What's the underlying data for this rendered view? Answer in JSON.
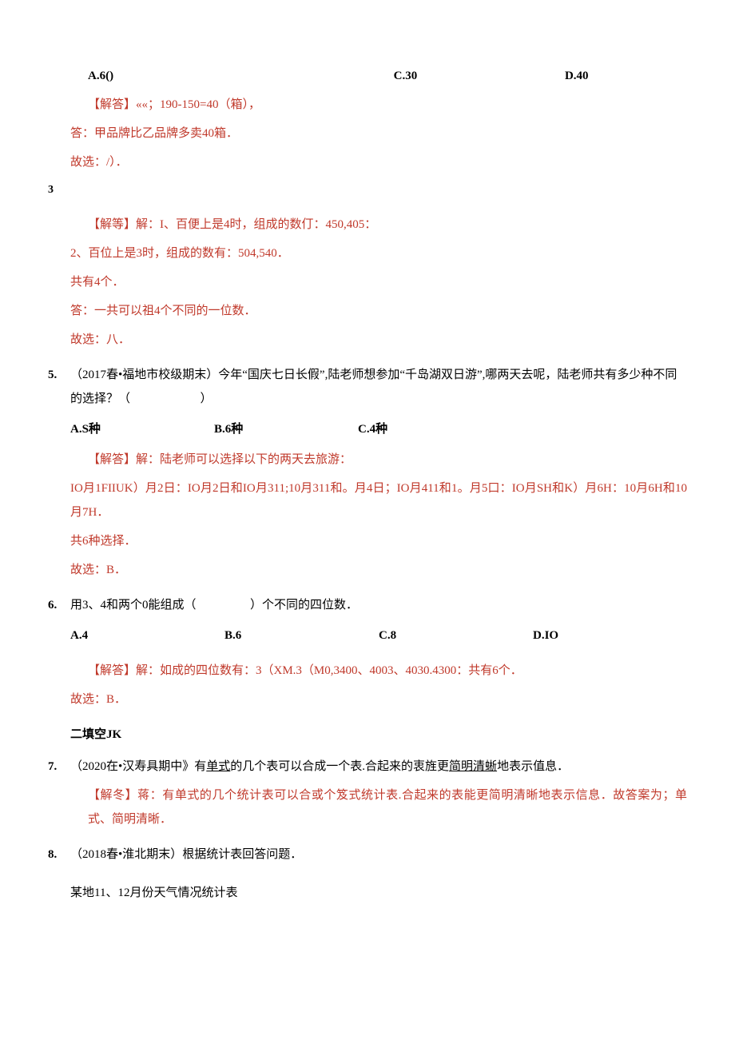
{
  "q_top_opts": {
    "a": "A.6()",
    "c": "C.30",
    "d": "D.40"
  },
  "ans_top": {
    "l1": "【解答】««；190-150=40（箱），",
    "l2": "答：甲品牌比乙品牌多卖40箱．",
    "l3": "故选：/）．"
  },
  "marker3": "3",
  "ans4": {
    "l1": "【解等】解：I、百便上是4时，组成的数仃：450,405：",
    "l2": "2、百位上是3时，组成的数有：504,540．",
    "l3": "共有4个．",
    "l4": "答：一共可以祖4个不同的一位数．",
    "l5": "故选：八．"
  },
  "q5": {
    "num": "5.",
    "stem": "（2017春•福地市校级期末）今年“国庆七日长假”,陆老师想参加“千岛湖双日游”,哪两天去呢，陆老师共有多少种不同的选择？（",
    "close": "）",
    "opts": {
      "a": "A.S种",
      "b": "B.6种",
      "c": "C.4种"
    },
    "ans": {
      "l1": "【解答】解：陆老师可以选择以下的两天去旅游：",
      "l2": "IO月1FIIUK）月2日：IO月2日和IO月311;10月311和。月4日；IO月411和1。月5口：IO月SH和K）月6H：10月6H和10月7H．",
      "l3": "共6种选择．",
      "l4": "故选：B．"
    }
  },
  "q6": {
    "num": "6.",
    "stem_a": "用3、4和两个0能组成（",
    "stem_b": "）个不同的四位数．",
    "opts": {
      "a": "A.4",
      "b": "B.6",
      "c": "C.8",
      "d": "D.IO"
    },
    "ans": {
      "l1": "【解答】解：如成的四位数有：3（XM.3（M0,3400、4003、4030.4300：共有6个．",
      "l2": "故选：B．"
    }
  },
  "sec2": "二填空JK",
  "q7": {
    "num": "7.",
    "pre": "（2020在•汉寿具期中》有",
    "u1": "单式",
    "mid": "的几个表可以合成一个表.合起来的衷旌更",
    "u2": "简明清蜥",
    "post": "地表示值息．",
    "ans": "【解冬】蒋：有单式的几个统计表可以合或个笈式统计表.合起来的表能更简明清晰地表示信息．故答案为；单式、简明清晰．"
  },
  "q8": {
    "num": "8.",
    "stem": "（2018春•淮北期末）根据统计表回答问题．",
    "caption": "某地11、12月份天气情况统计表"
  }
}
